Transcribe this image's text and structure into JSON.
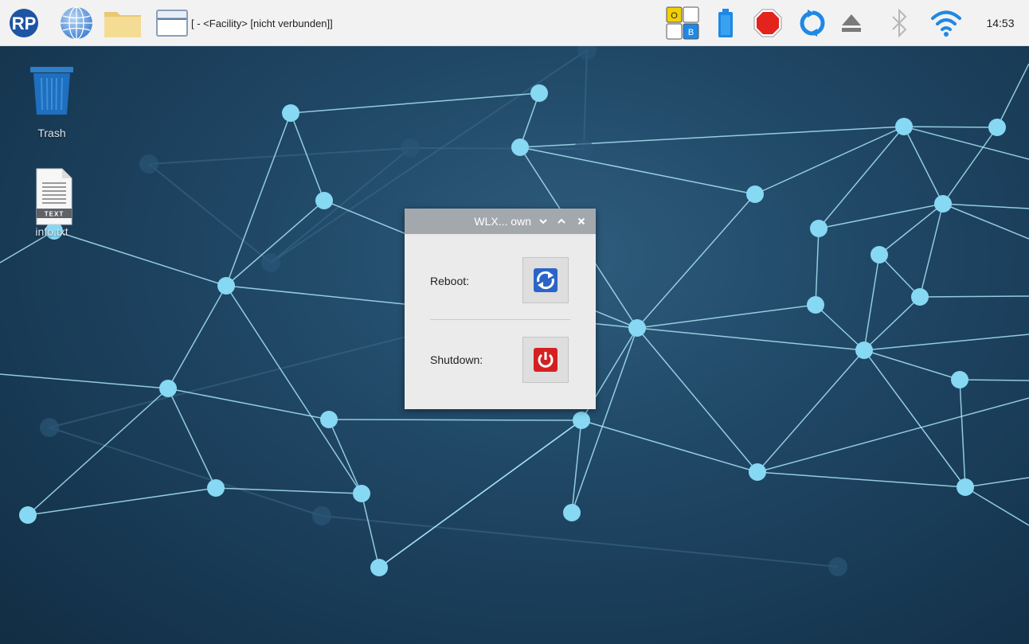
{
  "taskbar": {
    "launchers": {
      "menu_icon": "raspberry-pi-menu-icon",
      "browser_icon": "globe-icon",
      "files_icon": "folder-icon"
    },
    "task": {
      "title": "[ - <Facility> [nicht verbunden]]",
      "icon": "window-icon"
    },
    "tray": {
      "keyboard": {
        "o": "O",
        "b": "B"
      },
      "battery_icon": "battery-icon",
      "stop_icon": "stop-icon",
      "sync_icon": "sync-icon",
      "eject_icon": "eject-icon",
      "bluetooth_icon": "bluetooth-icon",
      "wifi_icon": "wifi-icon",
      "clock": "14:53"
    }
  },
  "desktop": {
    "icons": [
      {
        "label": "Trash",
        "icon": "trash-icon"
      },
      {
        "label": "info.txt",
        "icon": "text-file-icon",
        "badge": "TEXT"
      }
    ]
  },
  "dialog": {
    "title": "WLX... own",
    "reboot_label": "Reboot:",
    "shutdown_label": "Shutdown:",
    "reboot_icon": "reboot-icon",
    "shutdown_icon": "power-icon"
  },
  "colors": {
    "node": "#86d8f3",
    "link": "#a8e4f5",
    "reboot_button": "#2a64c8",
    "shutdown_button": "#d42020",
    "stop_sign": "#e3231c",
    "accent_blue": "#1e88e5"
  }
}
